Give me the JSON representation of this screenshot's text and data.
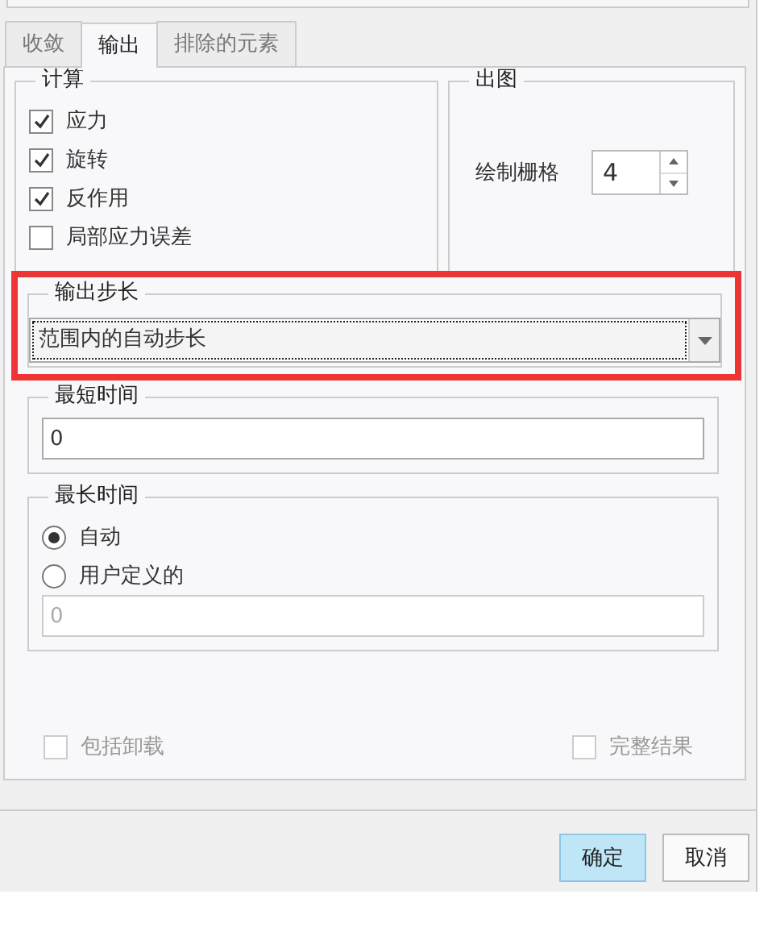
{
  "tabs": [
    {
      "label": "收敛",
      "selected": false
    },
    {
      "label": "输出",
      "selected": true
    },
    {
      "label": "排除的元素",
      "selected": false
    }
  ],
  "calculation": {
    "title": "计算",
    "items": [
      {
        "label": "应力",
        "checked": true
      },
      {
        "label": "旋转",
        "checked": true
      },
      {
        "label": "反作用",
        "checked": true
      },
      {
        "label": "局部应力误差",
        "checked": false
      }
    ]
  },
  "plotting": {
    "title": "出图",
    "label": "绘制栅格",
    "value": "4"
  },
  "output_step": {
    "title": "输出步长",
    "highlighted": true,
    "value": "范围内的自动步长"
  },
  "min_time": {
    "title": "最短时间",
    "value": "0"
  },
  "max_time": {
    "title": "最长时间",
    "options": [
      {
        "label": "自动",
        "selected": true
      },
      {
        "label": "用户定义的",
        "selected": false
      }
    ],
    "value": "0",
    "disabled": true
  },
  "bottom_options": [
    {
      "label": "包括卸载",
      "checked": false,
      "disabled": true
    },
    {
      "label": "完整结果",
      "checked": false,
      "disabled": true
    }
  ],
  "buttons": [
    {
      "label": "确定",
      "default": true
    },
    {
      "label": "取消",
      "default": false
    }
  ]
}
